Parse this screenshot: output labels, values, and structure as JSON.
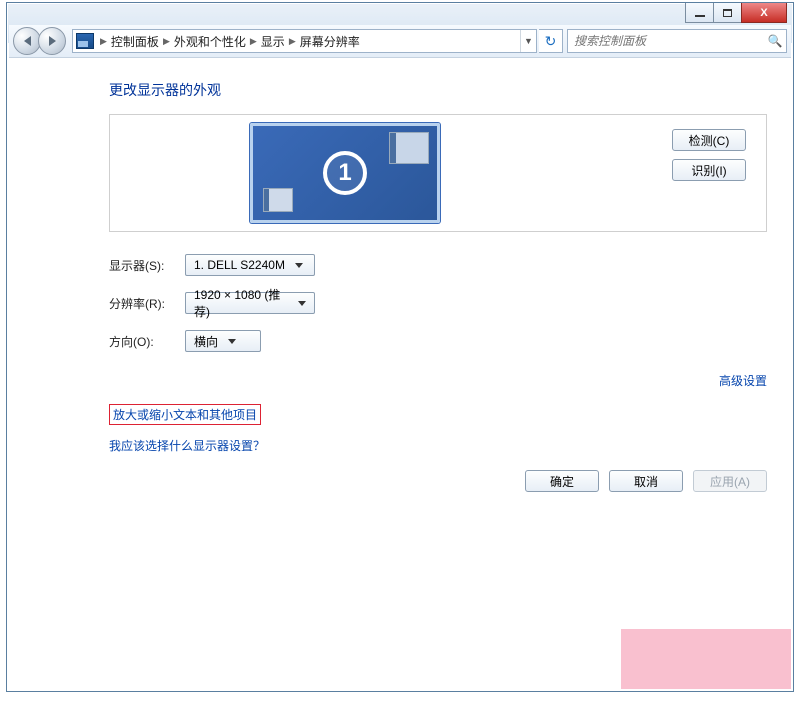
{
  "caption": {
    "minimize": "–",
    "maximize": "□",
    "close": "X"
  },
  "breadcrumbs": {
    "items": [
      "控制面板",
      "外观和个性化",
      "显示",
      "屏幕分辨率"
    ]
  },
  "search": {
    "placeholder": "搜索控制面板"
  },
  "heading": "更改显示器的外观",
  "monitor": {
    "number": "1"
  },
  "side_buttons": {
    "detect": "检测(C)",
    "identify": "识别(I)"
  },
  "form": {
    "display": {
      "label": "显示器(S):",
      "value": "1. DELL S2240M"
    },
    "resolution": {
      "label": "分辨率(R):",
      "value": "1920 × 1080 (推荐)"
    },
    "orientation": {
      "label": "方向(O):",
      "value": "横向"
    }
  },
  "links": {
    "advanced": "高级设置",
    "zoom_text": "放大或缩小文本和其他项目",
    "which_settings": "我应该选择什么显示器设置？"
  },
  "dlg": {
    "ok": "确定",
    "cancel": "取消",
    "apply": "应用(A)"
  }
}
